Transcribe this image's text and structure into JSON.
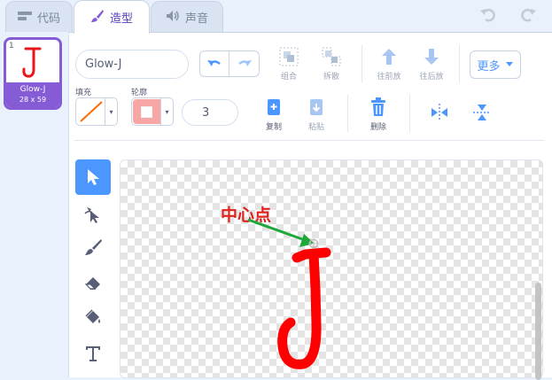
{
  "tabs": [
    {
      "label": "代码",
      "icon": "code-icon"
    },
    {
      "label": "造型",
      "icon": "brush-icon"
    },
    {
      "label": "声音",
      "icon": "speaker-icon"
    }
  ],
  "costume": {
    "number": "1",
    "name": "Glow-J",
    "size": "28 x 59",
    "glyph": "J"
  },
  "editor": {
    "costume_name_value": "Glow-J",
    "fill_label": "填充",
    "outline_label": "轮廓",
    "outline_width": "3",
    "group_label": "组合",
    "ungroup_label": "拆散",
    "forward_label": "往前放",
    "backward_label": "往后放",
    "more_label": "更多",
    "copy_label": "复制",
    "paste_label": "粘贴",
    "delete_label": "删除"
  },
  "canvas": {
    "annotation": "中心点",
    "glyph": "J"
  },
  "colors": {
    "accent": "#855cd6",
    "blue": "#4c97ff",
    "annotation": "#e0211c",
    "arrow": "#1fa83a",
    "fill_line": "#ff6a00",
    "outline_swatch": "#f7a6a6"
  }
}
